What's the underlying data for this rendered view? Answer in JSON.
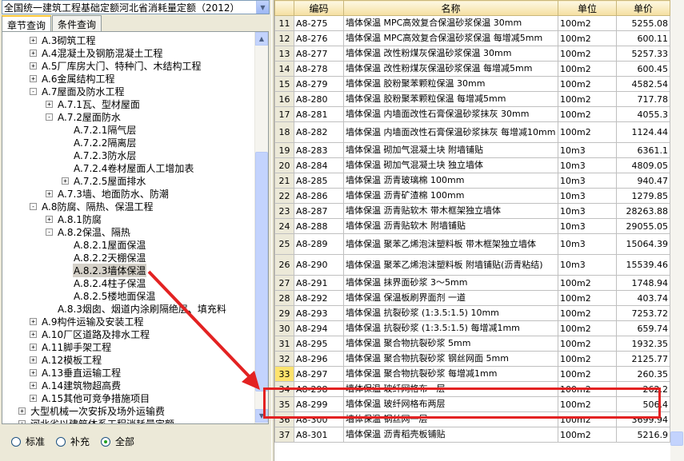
{
  "left_pane": {
    "dropdown_value": "全国统一建筑工程基础定额河北省消耗量定额（2012）",
    "tabs": [
      {
        "label": "章节查询",
        "active": true
      },
      {
        "label": "条件查询",
        "active": false
      }
    ],
    "tree": [
      {
        "label": "A.3砌筑工程",
        "indent": 0,
        "expander": "+"
      },
      {
        "label": "A.4混凝土及钢筋混凝土工程",
        "indent": 0,
        "expander": "+"
      },
      {
        "label": "A.5厂库房大门、特种门、木结构工程",
        "indent": 0,
        "expander": "+"
      },
      {
        "label": "A.6金属结构工程",
        "indent": 0,
        "expander": "+"
      },
      {
        "label": "A.7屋面及防水工程",
        "indent": 0,
        "expander": "-"
      },
      {
        "label": "A.7.1瓦、型材屋面",
        "indent": 1,
        "expander": "+"
      },
      {
        "label": "A.7.2屋面防水",
        "indent": 1,
        "expander": "-"
      },
      {
        "label": "A.7.2.1隔气层",
        "indent": 2,
        "expander": ""
      },
      {
        "label": "A.7.2.2隔离层",
        "indent": 2,
        "expander": ""
      },
      {
        "label": "A.7.2.3防水层",
        "indent": 2,
        "expander": ""
      },
      {
        "label": "A.7.2.4卷材屋面人工增加表",
        "indent": 2,
        "expander": ""
      },
      {
        "label": "A.7.2.5屋面排水",
        "indent": 2,
        "expander": "+"
      },
      {
        "label": "A.7.3墙、地面防水、防潮",
        "indent": 1,
        "expander": "+"
      },
      {
        "label": "A.8防腐、隔热、保温工程",
        "indent": 0,
        "expander": "-"
      },
      {
        "label": "A.8.1防腐",
        "indent": 1,
        "expander": "+"
      },
      {
        "label": "A.8.2保温、隔热",
        "indent": 1,
        "expander": "-"
      },
      {
        "label": "A.8.2.1屋面保温",
        "indent": 2,
        "expander": ""
      },
      {
        "label": "A.8.2.2天棚保温",
        "indent": 2,
        "expander": ""
      },
      {
        "label": "A.8.2.3墙体保温",
        "indent": 2,
        "expander": "",
        "selected": true
      },
      {
        "label": "A.8.2.4柱子保温",
        "indent": 2,
        "expander": ""
      },
      {
        "label": "A.8.2.5楼地面保温",
        "indent": 2,
        "expander": ""
      },
      {
        "label": "A.8.3烟囱、烟道内涂刷隔绝层、填充料",
        "indent": 1,
        "expander": ""
      },
      {
        "label": "A.9构件运输及安装工程",
        "indent": 0,
        "expander": "+"
      },
      {
        "label": "A.10厂区道路及排水工程",
        "indent": 0,
        "expander": "+"
      },
      {
        "label": "A.11脚手架工程",
        "indent": 0,
        "expander": "+"
      },
      {
        "label": "A.12模板工程",
        "indent": 0,
        "expander": "+"
      },
      {
        "label": "A.13垂直运输工程",
        "indent": 0,
        "expander": "+"
      },
      {
        "label": "A.14建筑物超高费",
        "indent": 0,
        "expander": "+"
      },
      {
        "label": "A.15其他可竞争措施项目",
        "indent": 0,
        "expander": "+"
      },
      {
        "label": "大型机械一次安拆及场外运输费",
        "indent": -1,
        "expander": "+"
      },
      {
        "label": "河北省以建筑体系工程消耗量定额",
        "indent": -1,
        "expander": "+"
      }
    ],
    "radios": [
      {
        "label": "标准",
        "checked": false
      },
      {
        "label": "补充",
        "checked": false
      },
      {
        "label": "全部",
        "checked": true
      }
    ]
  },
  "table": {
    "headers": [
      "",
      "编码",
      "名称",
      "单位",
      "单价"
    ],
    "rows": [
      {
        "n": "11",
        "code": "A8-275",
        "name": "墙体保温 MPC高效复合保温砂浆保温 30mm",
        "unit": "100m2",
        "price": "5255.08"
      },
      {
        "n": "12",
        "code": "A8-276",
        "name": "墙体保温 MPC高效复合保温砂浆保温 每增减5mm",
        "unit": "100m2",
        "price": "600.11"
      },
      {
        "n": "13",
        "code": "A8-277",
        "name": "墙体保温 改性粉煤灰保温砂浆保温 30mm",
        "unit": "100m2",
        "price": "5257.33"
      },
      {
        "n": "14",
        "code": "A8-278",
        "name": "墙体保温 改性粉煤灰保温砂浆保温 每增减5mm",
        "unit": "100m2",
        "price": "600.45"
      },
      {
        "n": "15",
        "code": "A8-279",
        "name": "墙体保温 胶粉聚苯颗粒保温 30mm",
        "unit": "100m2",
        "price": "4582.54"
      },
      {
        "n": "16",
        "code": "A8-280",
        "name": "墙体保温 胶粉聚苯颗粒保温 每增减5mm",
        "unit": "100m2",
        "price": "717.78"
      },
      {
        "n": "17",
        "code": "A8-281",
        "name": "墙体保温 内墙面改性石膏保温砂浆抹灰 30mm",
        "unit": "100m2",
        "price": "4055.3"
      },
      {
        "n": "18",
        "code": "A8-282",
        "name": "墙体保温 内墙面改性石膏保温砂浆抹灰 每增减10mm",
        "unit": "100m2",
        "price": "1124.44",
        "tall": true
      },
      {
        "n": "19",
        "code": "A8-283",
        "name": "墙体保温 砌加气混凝土块 附墙铺贴",
        "unit": "10m3",
        "price": "6361.1"
      },
      {
        "n": "20",
        "code": "A8-284",
        "name": "墙体保温 砌加气混凝土块 独立墙体",
        "unit": "10m3",
        "price": "4809.05"
      },
      {
        "n": "21",
        "code": "A8-285",
        "name": "墙体保温 沥青玻璃棉 100mm",
        "unit": "10m3",
        "price": "940.47"
      },
      {
        "n": "22",
        "code": "A8-286",
        "name": "墙体保温 沥青矿渣棉 100mm",
        "unit": "10m3",
        "price": "1279.85"
      },
      {
        "n": "23",
        "code": "A8-287",
        "name": "墙体保温 沥青贴软木 带木框架独立墙体",
        "unit": "10m3",
        "price": "28263.88"
      },
      {
        "n": "24",
        "code": "A8-288",
        "name": "墙体保温 沥青贴软木 附墙铺贴",
        "unit": "10m3",
        "price": "29055.05"
      },
      {
        "n": "25",
        "code": "A8-289",
        "name": "墙体保温 聚苯乙烯泡沫塑料板 带木框架独立墙体",
        "unit": "10m3",
        "price": "15064.39",
        "tall": true
      },
      {
        "n": "26",
        "code": "A8-290",
        "name": "墙体保温 聚苯乙烯泡沫塑料板 附墙铺贴(沥青粘结)",
        "unit": "10m3",
        "price": "15539.46",
        "tall": true
      },
      {
        "n": "27",
        "code": "A8-291",
        "name": "墙体保温 抹界面砂浆 3～5mm",
        "unit": "100m2",
        "price": "1748.94"
      },
      {
        "n": "28",
        "code": "A8-292",
        "name": "墙体保温 保温板刷界面剂 一道",
        "unit": "100m2",
        "price": "403.74"
      },
      {
        "n": "29",
        "code": "A8-293",
        "name": "墙体保温 抗裂砂浆 (1:3.5:1.5) 10mm",
        "unit": "100m2",
        "price": "7253.72"
      },
      {
        "n": "30",
        "code": "A8-294",
        "name": "墙体保温 抗裂砂浆 (1:3.5:1.5) 每增减1mm",
        "unit": "100m2",
        "price": "659.74"
      },
      {
        "n": "31",
        "code": "A8-295",
        "name": "墙体保温 聚合物抗裂砂浆 5mm",
        "unit": "100m2",
        "price": "1932.35"
      },
      {
        "n": "32",
        "code": "A8-296",
        "name": "墙体保温 聚合物抗裂砂浆 钢丝网面 5mm",
        "unit": "100m2",
        "price": "2125.77"
      },
      {
        "n": "33",
        "code": "A8-297",
        "name": "墙体保温 聚合物抗裂砂浆 每增减1mm",
        "unit": "100m2",
        "price": "260.35",
        "current": true
      },
      {
        "n": "34",
        "code": "A8-298",
        "name": "墙体保温 玻纤网格布一层",
        "unit": "100m2",
        "price": "262.2"
      },
      {
        "n": "35",
        "code": "A8-299",
        "name": "墙体保温 玻纤网格布两层",
        "unit": "100m2",
        "price": "506.4"
      },
      {
        "n": "36",
        "code": "A8-300",
        "name": "墙体保温 钢丝网一层",
        "unit": "100m2",
        "price": "3699.94"
      },
      {
        "n": "37",
        "code": "A8-301",
        "name": "墙体保温 沥青稻壳板铺贴",
        "unit": "100m2",
        "price": "5216.9"
      }
    ]
  },
  "colors": {
    "annotation_red": "#e32222",
    "current_row_marker": "#ffe36d",
    "header_gold": "#f5dfa0"
  }
}
